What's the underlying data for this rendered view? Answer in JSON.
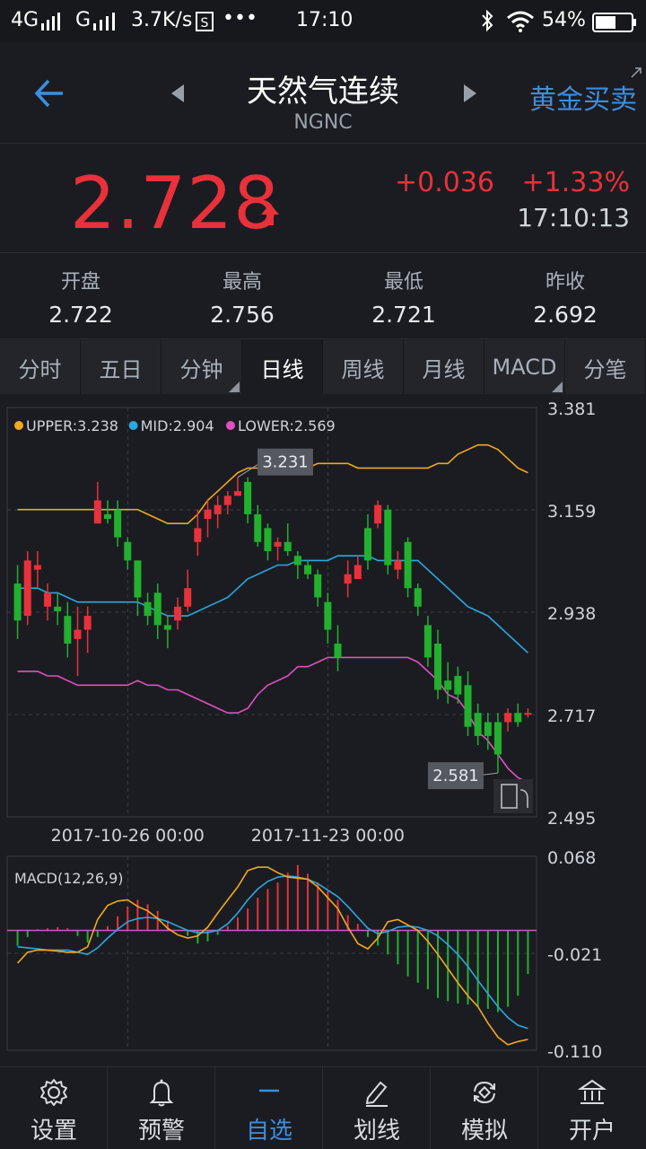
{
  "status_bar": {
    "network": "4G",
    "network2": "G",
    "speed": "3.7K/s",
    "dots": "•••",
    "time": "17:10",
    "battery": "54%"
  },
  "header": {
    "title": "天然气连续",
    "code": "NGNC",
    "trade_label": "黄金买卖"
  },
  "quote": {
    "price": "2.728",
    "change": "+0.036",
    "percent": "+1.33%",
    "time": "17:10:13",
    "accent_up": "#e8313a"
  },
  "stats": [
    {
      "label": "开盘",
      "value": "2.722"
    },
    {
      "label": "最高",
      "value": "2.756"
    },
    {
      "label": "最低",
      "value": "2.721"
    },
    {
      "label": "昨收",
      "value": "2.692"
    }
  ],
  "tabs": [
    {
      "label": "分时",
      "active": false,
      "corner": false
    },
    {
      "label": "五日",
      "active": false,
      "corner": false
    },
    {
      "label": "分钟",
      "active": false,
      "corner": true
    },
    {
      "label": "日线",
      "active": true,
      "corner": false
    },
    {
      "label": "周线",
      "active": false,
      "corner": false
    },
    {
      "label": "月线",
      "active": false,
      "corner": false
    },
    {
      "label": "MACD",
      "active": false,
      "corner": true
    },
    {
      "label": "分笔",
      "active": false,
      "corner": false
    }
  ],
  "chart_data": [
    {
      "type": "candlestick",
      "legend": [
        {
          "label": "UPPER:3.238",
          "color": "#f0a820"
        },
        {
          "label": "MID:2.904",
          "color": "#2aa8e0"
        },
        {
          "label": "LOWER:2.569",
          "color": "#e050c0"
        }
      ],
      "y_ticks": [
        "3.381",
        "3.159",
        "2.938",
        "2.717",
        "2.495"
      ],
      "ylim": [
        2.495,
        3.381
      ],
      "x_ticks": [
        "2017-10-26 00:00",
        "2017-11-23 00:00"
      ],
      "max_label": "3.231",
      "min_label": "2.581",
      "colors": {
        "up": "#e8313a",
        "down": "#22b02e"
      },
      "candles": [
        [
          3.0,
          3.04,
          2.88,
          2.92
        ],
        [
          2.93,
          3.07,
          2.91,
          3.05
        ],
        [
          3.03,
          3.07,
          2.99,
          3.04
        ],
        [
          2.95,
          3.0,
          2.92,
          2.98
        ],
        [
          2.95,
          2.98,
          2.91,
          2.94
        ],
        [
          2.93,
          2.96,
          2.84,
          2.87
        ],
        [
          2.88,
          2.95,
          2.8,
          2.9
        ],
        [
          2.9,
          2.95,
          2.85,
          2.93
        ],
        [
          3.13,
          3.22,
          3.13,
          3.18
        ],
        [
          3.15,
          3.18,
          3.13,
          3.14
        ],
        [
          3.16,
          3.18,
          3.08,
          3.1
        ],
        [
          3.09,
          3.1,
          3.03,
          3.05
        ],
        [
          3.05,
          3.05,
          2.93,
          2.97
        ],
        [
          2.96,
          2.98,
          2.91,
          2.93
        ],
        [
          2.98,
          3.0,
          2.88,
          2.91
        ],
        [
          2.91,
          2.93,
          2.86,
          2.9
        ],
        [
          2.92,
          2.97,
          2.9,
          2.95
        ],
        [
          2.95,
          3.03,
          2.94,
          2.99
        ],
        [
          3.09,
          3.16,
          3.06,
          3.12
        ],
        [
          3.14,
          3.18,
          3.1,
          3.16
        ],
        [
          3.15,
          3.19,
          3.12,
          3.17
        ],
        [
          3.17,
          3.2,
          3.15,
          3.19
        ],
        [
          3.19,
          3.23,
          3.19,
          3.2
        ],
        [
          3.22,
          3.23,
          3.13,
          3.15
        ],
        [
          3.15,
          3.17,
          3.08,
          3.09
        ],
        [
          3.12,
          3.13,
          3.05,
          3.07
        ],
        [
          3.08,
          3.1,
          3.05,
          3.09
        ],
        [
          3.09,
          3.13,
          3.06,
          3.07
        ],
        [
          3.06,
          3.07,
          3.01,
          3.04
        ],
        [
          3.04,
          3.05,
          3.01,
          3.02
        ],
        [
          3.02,
          3.03,
          2.95,
          2.97
        ],
        [
          2.96,
          2.98,
          2.87,
          2.9
        ],
        [
          2.87,
          2.91,
          2.81,
          2.84
        ],
        [
          3.0,
          3.05,
          2.97,
          3.02
        ],
        [
          3.01,
          3.06,
          3.01,
          3.04
        ],
        [
          3.12,
          3.15,
          3.03,
          3.05
        ],
        [
          3.13,
          3.18,
          3.12,
          3.17
        ],
        [
          3.16,
          3.17,
          3.02,
          3.04
        ],
        [
          3.03,
          3.07,
          3.01,
          3.05
        ],
        [
          3.09,
          3.1,
          2.97,
          2.99
        ],
        [
          2.99,
          3.0,
          2.93,
          2.95
        ],
        [
          2.91,
          2.93,
          2.82,
          2.84
        ],
        [
          2.87,
          2.9,
          2.75,
          2.77
        ],
        [
          2.79,
          2.83,
          2.74,
          2.77
        ],
        [
          2.8,
          2.82,
          2.74,
          2.76
        ],
        [
          2.78,
          2.81,
          2.67,
          2.69
        ],
        [
          2.72,
          2.74,
          2.65,
          2.67
        ],
        [
          2.7,
          2.72,
          2.64,
          2.67
        ],
        [
          2.7,
          2.72,
          2.59,
          2.63
        ],
        [
          2.7,
          2.73,
          2.68,
          2.72
        ],
        [
          2.72,
          2.74,
          2.69,
          2.7
        ],
        [
          2.72,
          2.73,
          2.71,
          2.72
        ]
      ],
      "upper": [
        3.16,
        3.16,
        3.16,
        3.16,
        3.16,
        3.16,
        3.16,
        3.16,
        3.16,
        3.16,
        3.16,
        3.16,
        3.16,
        3.15,
        3.14,
        3.13,
        3.13,
        3.13,
        3.15,
        3.18,
        3.2,
        3.22,
        3.24,
        3.25,
        3.25,
        3.25,
        3.25,
        3.25,
        3.25,
        3.25,
        3.26,
        3.26,
        3.26,
        3.26,
        3.25,
        3.25,
        3.25,
        3.25,
        3.25,
        3.25,
        3.25,
        3.25,
        3.26,
        3.26,
        3.28,
        3.29,
        3.3,
        3.3,
        3.29,
        3.27,
        3.25,
        3.24
      ],
      "mid": [
        2.99,
        2.99,
        2.99,
        2.98,
        2.98,
        2.97,
        2.96,
        2.96,
        2.96,
        2.96,
        2.96,
        2.96,
        2.96,
        2.95,
        2.94,
        2.93,
        2.93,
        2.93,
        2.94,
        2.95,
        2.96,
        2.97,
        2.99,
        3.01,
        3.02,
        3.03,
        3.04,
        3.04,
        3.05,
        3.05,
        3.05,
        3.05,
        3.06,
        3.06,
        3.06,
        3.06,
        3.05,
        3.05,
        3.05,
        3.05,
        3.05,
        3.03,
        3.01,
        2.99,
        2.97,
        2.95,
        2.94,
        2.93,
        2.91,
        2.89,
        2.87,
        2.85
      ],
      "lower": [
        2.81,
        2.81,
        2.81,
        2.8,
        2.8,
        2.79,
        2.78,
        2.78,
        2.78,
        2.78,
        2.78,
        2.78,
        2.79,
        2.78,
        2.78,
        2.77,
        2.77,
        2.76,
        2.75,
        2.74,
        2.73,
        2.72,
        2.72,
        2.73,
        2.76,
        2.78,
        2.79,
        2.8,
        2.82,
        2.82,
        2.83,
        2.84,
        2.84,
        2.84,
        2.84,
        2.84,
        2.84,
        2.84,
        2.84,
        2.84,
        2.83,
        2.81,
        2.79,
        2.76,
        2.75,
        2.72,
        2.68,
        2.66,
        2.63,
        2.6,
        2.58,
        2.57
      ]
    },
    {
      "type": "macd",
      "title": "MACD(12,26,9)",
      "y_ticks": [
        "0.068",
        "-0.021",
        "-0.110"
      ],
      "ylim": [
        -0.11,
        0.068
      ],
      "colors": {
        "dif": "#f0a820",
        "dea": "#2aa8e0",
        "bar_up": "#e8313a",
        "bar_down": "#22b02e",
        "zero": "#c060c0"
      },
      "hist": [
        -0.014,
        -0.006,
        0.001,
        0.002,
        0.003,
        0.002,
        -0.005,
        -0.011,
        -0.006,
        0.004,
        0.013,
        0.022,
        0.028,
        0.024,
        0.018,
        0.009,
        0.0,
        -0.005,
        -0.012,
        -0.01,
        -0.004,
        0.004,
        0.012,
        0.02,
        0.03,
        0.038,
        0.044,
        0.053,
        0.06,
        0.052,
        0.044,
        0.036,
        0.028,
        0.014,
        0.006,
        -0.006,
        -0.014,
        -0.022,
        -0.031,
        -0.042,
        -0.048,
        -0.054,
        -0.062,
        -0.065,
        -0.067,
        -0.068,
        -0.07,
        -0.072,
        -0.075,
        -0.07,
        -0.06,
        -0.04
      ],
      "dif": [
        -0.03,
        -0.02,
        -0.018,
        -0.018,
        -0.019,
        -0.02,
        -0.02,
        -0.015,
        0.01,
        0.023,
        0.027,
        0.028,
        0.022,
        0.018,
        0.011,
        0.002,
        -0.004,
        -0.007,
        -0.005,
        0.003,
        0.016,
        0.028,
        0.04,
        0.055,
        0.058,
        0.058,
        0.053,
        0.049,
        0.048,
        0.047,
        0.04,
        0.03,
        0.02,
        0.003,
        -0.012,
        -0.017,
        -0.007,
        0.008,
        0.01,
        0.005,
        0.0,
        -0.01,
        -0.022,
        -0.035,
        -0.048,
        -0.06,
        -0.07,
        -0.085,
        -0.098,
        -0.105,
        -0.102,
        -0.1
      ],
      "dea": [
        -0.015,
        -0.016,
        -0.017,
        -0.018,
        -0.018,
        -0.018,
        -0.02,
        -0.022,
        -0.016,
        -0.007,
        0.001,
        0.008,
        0.011,
        0.012,
        0.011,
        0.008,
        0.004,
        0.0,
        -0.002,
        -0.002,
        0.0,
        0.006,
        0.016,
        0.028,
        0.038,
        0.045,
        0.049,
        0.05,
        0.049,
        0.047,
        0.043,
        0.037,
        0.031,
        0.022,
        0.012,
        0.002,
        -0.003,
        -0.001,
        0.003,
        0.004,
        0.003,
        0.0,
        -0.005,
        -0.013,
        -0.022,
        -0.033,
        -0.046,
        -0.058,
        -0.07,
        -0.08,
        -0.087,
        -0.09
      ]
    }
  ],
  "bottom_nav": [
    {
      "label": "设置",
      "icon": "settings-gear-icon",
      "active": false
    },
    {
      "label": "预警",
      "icon": "bell-icon",
      "active": false
    },
    {
      "label": "自选",
      "icon": "minus-icon",
      "active": true
    },
    {
      "label": "划线",
      "icon": "pen-icon",
      "active": false
    },
    {
      "label": "模拟",
      "icon": "sync-icon",
      "active": false
    },
    {
      "label": "开户",
      "icon": "bank-icon",
      "active": false
    }
  ]
}
